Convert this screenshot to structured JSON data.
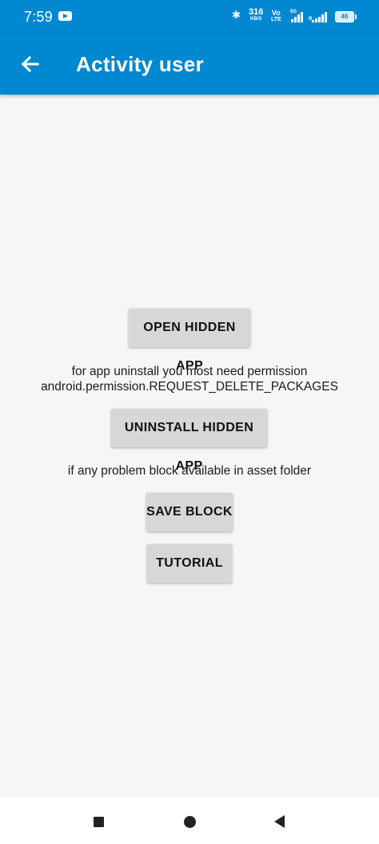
{
  "status_bar": {
    "time": "7:59",
    "net_speed_value": "316",
    "net_speed_unit": "KB/S",
    "volte_top": "Vo",
    "volte_bottom": "LTE",
    "sim1_tag": "5G",
    "sim2_tag": "R",
    "battery": "46"
  },
  "app_bar": {
    "title": "Activity user"
  },
  "main": {
    "open_button": "OPEN HIDDEN APP",
    "permission_text_line1": "for app uninstall you most need permission",
    "permission_text_line2": "android.permission.REQUEST_DELETE_PACKAGES",
    "uninstall_button": "UNINSTALL HIDDEN APP",
    "asset_text": "if any problem block available in asset folder",
    "save_button": "SAVE BLOCK",
    "tutorial_button": "TUTORIAL"
  },
  "colors": {
    "primary": "#0288d1",
    "background": "#f6f6f6",
    "button": "#d7d7d7"
  }
}
